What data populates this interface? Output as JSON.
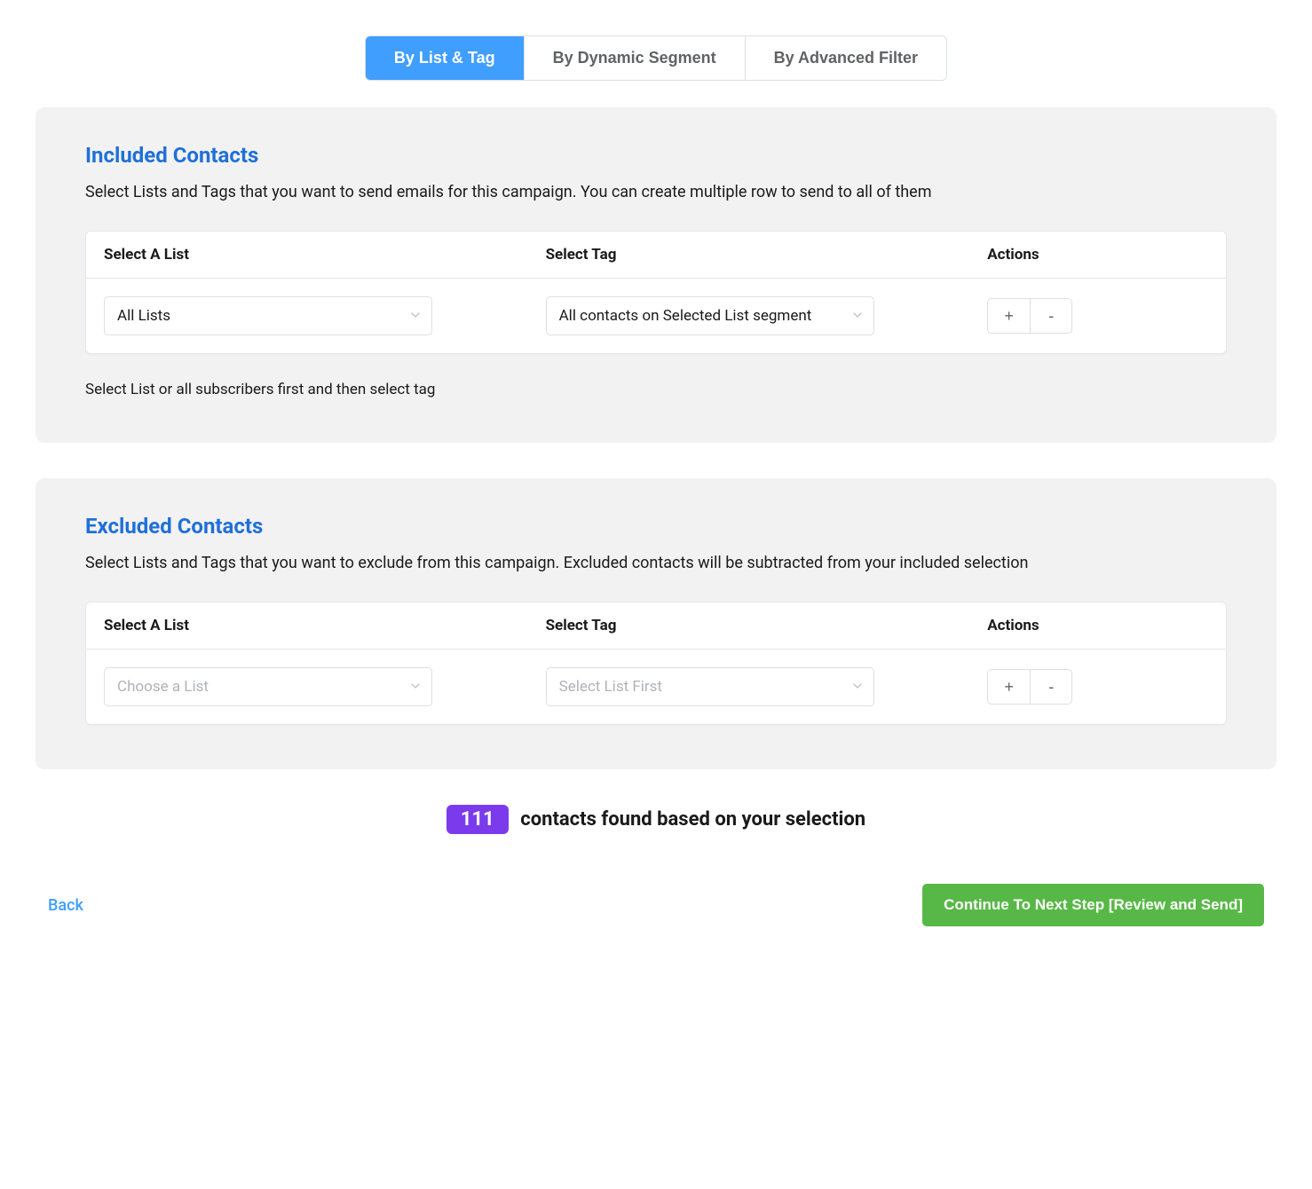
{
  "tabs": {
    "items": [
      {
        "label": "By List & Tag",
        "active": true
      },
      {
        "label": "By Dynamic Segment",
        "active": false
      },
      {
        "label": "By Advanced Filter",
        "active": false
      }
    ]
  },
  "included": {
    "title": "Included Contacts",
    "description": "Select Lists and Tags that you want to send emails for this campaign. You can create multiple row to send to all of them",
    "columns": {
      "list": "Select A List",
      "tag": "Select Tag",
      "actions": "Actions"
    },
    "row": {
      "list_value": "All Lists",
      "tag_value": "All contacts on Selected List segment",
      "add_label": "+",
      "remove_label": "-"
    },
    "hint": "Select List or all subscribers first and then select tag"
  },
  "excluded": {
    "title": "Excluded Contacts",
    "description": "Select Lists and Tags that you want to exclude from this campaign. Excluded contacts will be subtracted from your included selection",
    "columns": {
      "list": "Select A List",
      "tag": "Select Tag",
      "actions": "Actions"
    },
    "row": {
      "list_placeholder": "Choose a List",
      "tag_placeholder": "Select List First",
      "add_label": "+",
      "remove_label": "-"
    }
  },
  "result": {
    "count": "111",
    "text": "contacts found based on your selection"
  },
  "footer": {
    "back_label": "Back",
    "continue_label": "Continue To Next Step [Review and Send]"
  }
}
